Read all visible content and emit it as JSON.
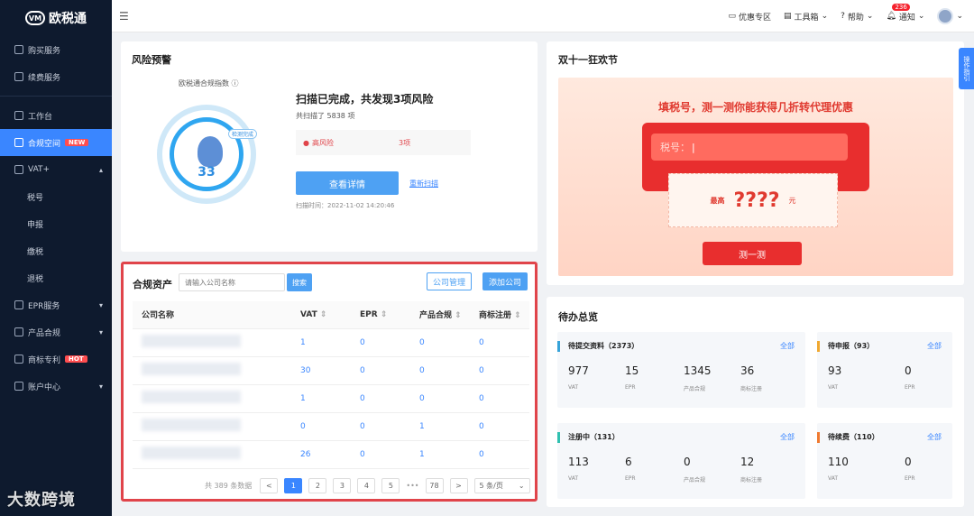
{
  "sidebar": {
    "logo": "欧税通",
    "items": [
      {
        "label": "购买服务"
      },
      {
        "label": "续费服务"
      },
      {
        "label": "工作台"
      },
      {
        "label": "合规空间",
        "badge": "NEW"
      },
      {
        "label": "VAT+"
      },
      {
        "label": "税号"
      },
      {
        "label": "申报"
      },
      {
        "label": "缴税"
      },
      {
        "label": "退税"
      },
      {
        "label": "EPR服务"
      },
      {
        "label": "产品合规"
      },
      {
        "label": "商标专利",
        "badge": "HOT"
      },
      {
        "label": "账户中心"
      }
    ]
  },
  "topbar": {
    "items": [
      "优惠专区",
      "工具箱",
      "帮助",
      "通知"
    ],
    "notif_count": "236"
  },
  "risk": {
    "title": "风险预警",
    "index_label": "欧税通合规指数",
    "status_tag": "检测完成",
    "score": "33",
    "headline": "扫描已完成，共发现3项风险",
    "scanned": "共扫描了 5838 项",
    "level_label": "高风险",
    "level_count": "3项",
    "detail_button": "查看详情",
    "rescan_link": "重新扫描",
    "scan_time": "扫描时间：2022-11-02 14:20:46"
  },
  "promo": {
    "title": "双十一狂欢节",
    "banner_heading": "填税号，测一测你能获得几折转代理优惠",
    "input_label": "税号：",
    "max_label": "最高",
    "unknown": "????",
    "unit": "元",
    "button": "测一测"
  },
  "assets": {
    "title": "合规资产",
    "search_placeholder": "请输入公司名称",
    "search_button": "搜索",
    "manage_button": "公司管理",
    "add_button": "添加公司",
    "columns": [
      "公司名称",
      "VAT",
      "EPR",
      "产品合规",
      "商标注册"
    ],
    "rows": [
      [
        "1",
        "0",
        "0",
        "0"
      ],
      [
        "30",
        "0",
        "0",
        "0"
      ],
      [
        "1",
        "0",
        "0",
        "0"
      ],
      [
        "0",
        "0",
        "1",
        "0"
      ],
      [
        "26",
        "0",
        "1",
        "0"
      ]
    ],
    "pagination": {
      "total": "共 389 条数据",
      "prev": "<",
      "pages": [
        "1",
        "2",
        "3",
        "4",
        "5",
        "•••",
        "78"
      ],
      "next": ">",
      "page_size": "5 条/页"
    }
  },
  "todo": {
    "title": "待办总览",
    "all_label": "全部",
    "boxes": [
      {
        "title": "待提交资料（2373）",
        "color": "#36a3d9",
        "stats": [
          {
            "value": "977",
            "label": "VAT"
          },
          {
            "value": "15",
            "label": "EPR"
          },
          {
            "value": "1345",
            "label": "产品合规"
          },
          {
            "value": "36",
            "label": "商标注册"
          }
        ]
      },
      {
        "title": "待申报（93）",
        "color": "#f0a830",
        "stats": [
          {
            "value": "93",
            "label": "VAT"
          },
          {
            "value": "0",
            "label": "EPR"
          }
        ]
      },
      {
        "title": "注册中（131）",
        "color": "#30c0b0",
        "stats": [
          {
            "value": "113",
            "label": "VAT"
          },
          {
            "value": "6",
            "label": "EPR"
          },
          {
            "value": "0",
            "label": "产品合规"
          },
          {
            "value": "12",
            "label": "商标注册"
          }
        ]
      },
      {
        "title": "待续费（110）",
        "color": "#f07a30",
        "stats": [
          {
            "value": "110",
            "label": "VAT"
          },
          {
            "value": "0",
            "label": "EPR"
          }
        ]
      }
    ]
  },
  "floating_tab": "操作指引",
  "watermark": "大数跨境"
}
